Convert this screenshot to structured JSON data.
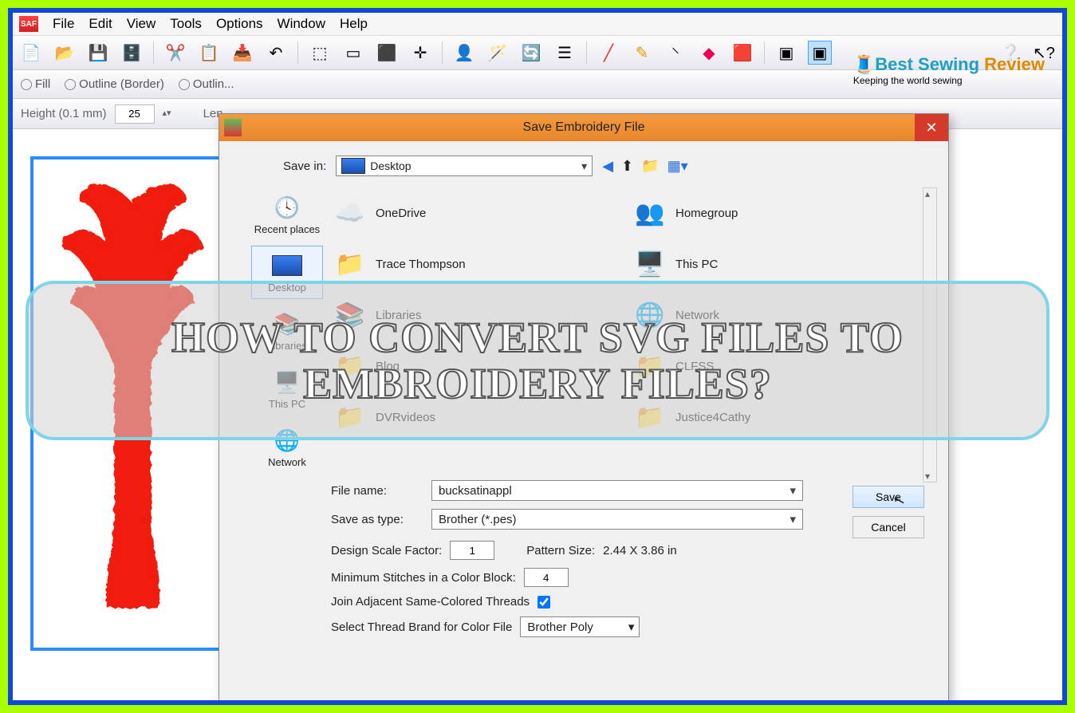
{
  "menubar": {
    "items": [
      "File",
      "Edit",
      "View",
      "Tools",
      "Options",
      "Window",
      "Help"
    ]
  },
  "optbar": {
    "fill": "Fill",
    "outline": "Outline (Border)",
    "outline2": "Outlin..."
  },
  "sizebar": {
    "heightLabel": "Height (0.1 mm)",
    "heightValue": "25",
    "lenLabel": "Len..."
  },
  "dialog": {
    "title": "Save Embroidery File",
    "saveInLabel": "Save in:",
    "saveInValue": "Desktop",
    "places": [
      {
        "label": "Recent places"
      },
      {
        "label": "Desktop",
        "selected": true
      },
      {
        "label": "Libraries"
      },
      {
        "label": "This PC"
      },
      {
        "label": "Network"
      }
    ],
    "files": [
      {
        "label": "OneDrive"
      },
      {
        "label": "Homegroup"
      },
      {
        "label": "Trace Thompson"
      },
      {
        "label": "This PC"
      },
      {
        "label": "Libraries"
      },
      {
        "label": "Network"
      },
      {
        "label": "Blog"
      },
      {
        "label": "CLFSS"
      },
      {
        "label": "DVRvideos"
      },
      {
        "label": "Justice4Cathy"
      }
    ],
    "fileNameLabel": "File name:",
    "fileNameValue": "bucksatinappl",
    "saveTypeLabel": "Save as type:",
    "saveTypeValue": "Brother (*.pes)",
    "saveBtn": "Save",
    "cancelBtn": "Cancel",
    "scaleLabel": "Design Scale Factor:",
    "scaleValue": "1",
    "patternLabel": "Pattern Size:",
    "patternValue": "2.44 X 3.86 in",
    "minStitchLabel": "Minimum Stitches in a Color Block:",
    "minStitchValue": "4",
    "joinLabel": "Join Adjacent Same-Colored Threads",
    "threadLabel": "Select Thread Brand for Color File",
    "threadValue": "Brother Poly"
  },
  "overlay": {
    "text": "HOW TO CONVERT SVG FILES TO EMBROIDERY FILES?"
  },
  "logo": {
    "brand1": "Best Sewing ",
    "brand2": "Review",
    "tag": "Keeping the world sewing"
  }
}
